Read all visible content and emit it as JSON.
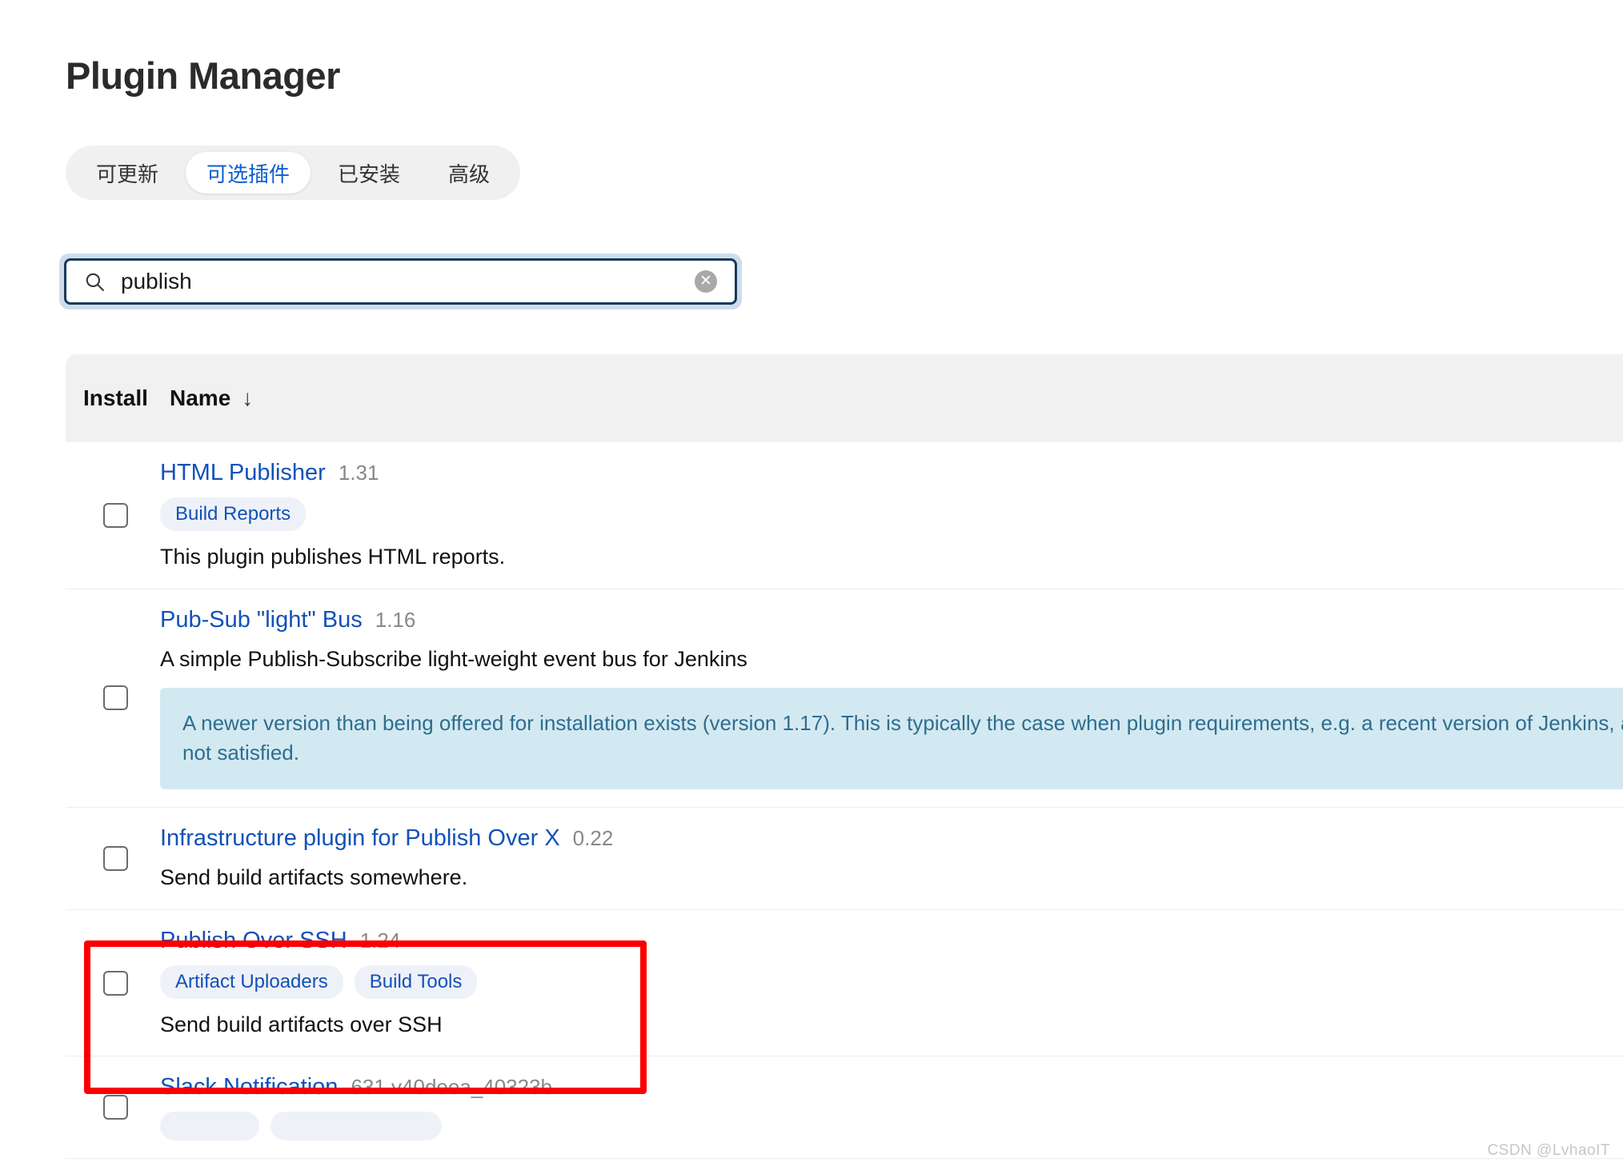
{
  "page": {
    "title": "Plugin Manager",
    "watermark": "CSDN @LvhaoIT"
  },
  "tabs": [
    {
      "label": "可更新",
      "active": false
    },
    {
      "label": "可选插件",
      "active": true
    },
    {
      "label": "已安装",
      "active": false
    },
    {
      "label": "高级",
      "active": false
    }
  ],
  "search": {
    "value": "publish",
    "placeholder": "",
    "icon": "search-icon",
    "clear_icon": "clear-icon"
  },
  "table": {
    "headers": {
      "install": "Install",
      "name": "Name",
      "sort_arrow": "↓"
    },
    "rows": [
      {
        "name": "HTML Publisher",
        "version": "1.31",
        "labels": [
          "Build Reports"
        ],
        "description": "This plugin publishes HTML reports.",
        "info": null,
        "checked": false
      },
      {
        "name": "Pub-Sub \"light\" Bus",
        "version": "1.16",
        "labels": [],
        "description": "A simple Publish-Subscribe light-weight event bus for Jenkins",
        "info": "A newer version than being offered for installation exists (version 1.17). This is typically the case when plugin requirements, e.g. a recent version of Jenkins, are not satisfied.",
        "checked": false
      },
      {
        "name": "Infrastructure plugin for Publish Over X",
        "version": "0.22",
        "labels": [],
        "description": "Send build artifacts somewhere.",
        "info": null,
        "checked": false
      },
      {
        "name": "Publish Over SSH",
        "version": "1.24",
        "labels": [
          "Artifact Uploaders",
          "Build Tools"
        ],
        "description": "Send build artifacts over SSH",
        "info": null,
        "checked": false,
        "highlighted": true
      },
      {
        "name": "Slack Notification",
        "version": "631.v40deea_40323b",
        "labels": [
          "",
          ""
        ],
        "description": "",
        "info": null,
        "checked": false
      }
    ]
  },
  "colors": {
    "link": "#1251b8",
    "active_tab_text": "#0b5fd0",
    "chip_bg": "#eef1f8",
    "info_bg": "#d3e9f2",
    "info_text": "#2e6e8e",
    "highlight_border": "#fb0000",
    "header_bg": "#f1f1f1",
    "search_border": "#16395c"
  }
}
